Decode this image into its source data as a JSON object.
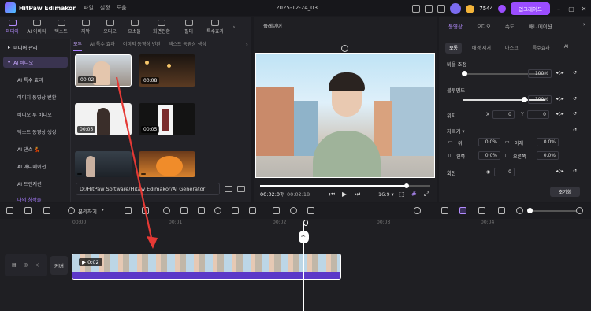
{
  "titlebar": {
    "app_name": "HitPaw Edimakor",
    "menus": [
      "파일",
      "설정",
      "도움"
    ],
    "project_name": "2025-12-24_03",
    "credits": "7544",
    "upgrade_label": "업그레이드"
  },
  "toolbar": {
    "items": [
      {
        "label": "미디어",
        "icon": "media-icon"
      },
      {
        "label": "AI 아바타",
        "icon": "avatar-icon"
      },
      {
        "label": "텍스트",
        "icon": "text-icon"
      },
      {
        "label": "자막",
        "icon": "subtitle-icon"
      },
      {
        "label": "오디오",
        "icon": "audio-icon"
      },
      {
        "label": "요소들",
        "icon": "elements-icon"
      },
      {
        "label": "화면전환",
        "icon": "transition-icon"
      },
      {
        "label": "필터",
        "icon": "filter-icon"
      },
      {
        "label": "특수효과",
        "icon": "effects-icon"
      }
    ]
  },
  "sidebar": {
    "groups": [
      "미디어 관리",
      "AI 비디오"
    ],
    "subitems": [
      "AI 특수 효과",
      "이미지 동영상 변환",
      "비디오 투 비디오",
      "텍스트 동영상 생성",
      "AI 댄스 💃",
      "AI 애니메이션",
      "AI 트랜지션",
      "나의 창작물"
    ]
  },
  "media_tabs": [
    "모두",
    "AI 특수 효과",
    "이미지 동영상 변환",
    "텍스트 동영상 생성"
  ],
  "thumbnails": [
    {
      "duration": "00:02"
    },
    {
      "duration": "00:08"
    },
    {
      "duration": "00:05"
    },
    {
      "duration": "00:05"
    },
    {
      "duration": ""
    },
    {
      "duration": ""
    }
  ],
  "path": "D:/HitPaw Software/Hitaw Edimakor/AI Generator",
  "player": {
    "title": "플레이어",
    "current_time": "00:02:07",
    "total_time": "00:02:18",
    "aspect": "16:9 ▾",
    "progress_fraction": 0.86
  },
  "properties": {
    "tabs": [
      "동영상",
      "오디오",
      "속도",
      "애니메이션"
    ],
    "subtabs": [
      "보통",
      "배경 제거",
      "마스크",
      "특수효과",
      "AI"
    ],
    "scale_label": "비율 조정",
    "scale_value": "100%",
    "opacity_label": "불투명도",
    "opacity_value": "100%",
    "position_label": "위치",
    "pos_x_label": "X",
    "pos_x": "0",
    "pos_y_label": "Y",
    "pos_y": "0",
    "crop_label": "자르기 ▾",
    "crop_top_label": "위",
    "crop_top": "0.0%",
    "crop_bottom_label": "아래",
    "crop_bottom": "0.0%",
    "crop_left_label": "왼쪽",
    "crop_left": "0.0%",
    "crop_right_label": "오른쪽",
    "crop_right": "0.0%",
    "rotate_label": "회전",
    "rotate_value": "0",
    "reset_label": "초기화"
  },
  "timeline": {
    "split_label": "분리하기",
    "ruler": [
      "00:00",
      "00:01",
      "00:02",
      "00:03",
      "00:04"
    ],
    "cover_label": "커버",
    "clip_duration": "0:02"
  },
  "colors": {
    "accent": "#a77cff",
    "clip": "#5b38c8",
    "arrow": "#e53935"
  }
}
